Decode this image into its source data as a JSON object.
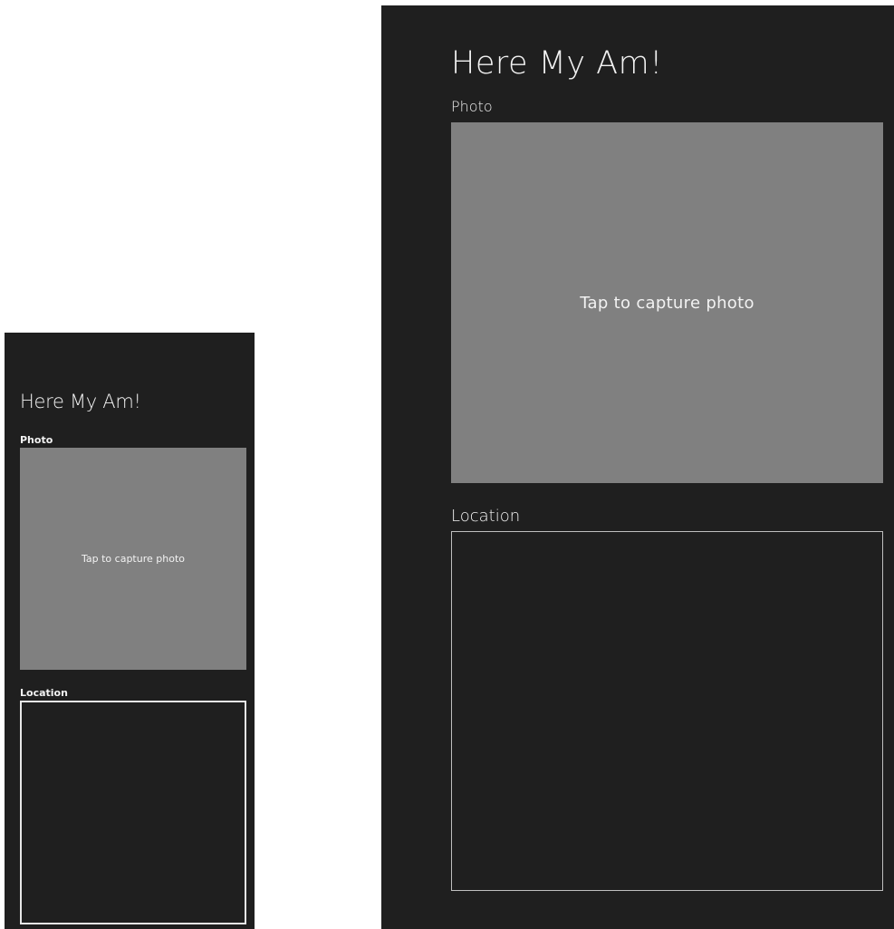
{
  "small_view": {
    "title": "Here My Am!",
    "photo_label": "Photo",
    "photo_prompt": "Tap to capture photo",
    "location_label": "Location"
  },
  "large_view": {
    "title": "Here My Am!",
    "photo_label": "Photo",
    "photo_prompt": "Tap to capture photo",
    "location_label": "Location"
  },
  "colors": {
    "app_background": "#1f1f1f",
    "photo_placeholder": "#808080",
    "text": "#f2f2f2",
    "page_background": "#ffffff"
  }
}
